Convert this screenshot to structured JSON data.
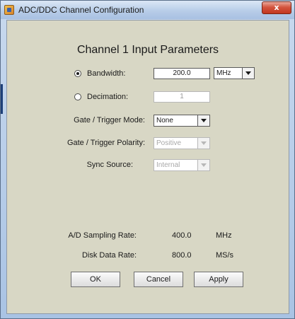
{
  "window": {
    "title": "ADC/DDC Channel Configuration",
    "close_glyph": "x"
  },
  "form": {
    "heading": "Channel 1 Input Parameters",
    "bandwidth": {
      "label": "Bandwidth:",
      "value": "200.0",
      "unit": "MHz",
      "selected": true
    },
    "decimation": {
      "label": "Decimation:",
      "value": "1",
      "selected": false
    },
    "gate_mode": {
      "label": "Gate / Trigger Mode:",
      "value": "None"
    },
    "gate_polarity": {
      "label": "Gate / Trigger Polarity:",
      "value": "Positive"
    },
    "sync_source": {
      "label": "Sync Source:",
      "value": "Internal"
    }
  },
  "info": {
    "sampling_rate": {
      "label": "A/D Sampling Rate:",
      "value": "400.0",
      "unit": "MHz"
    },
    "disk_rate": {
      "label": "Disk Data Rate:",
      "value": "800.0",
      "unit": "MS/s"
    }
  },
  "buttons": {
    "ok": "OK",
    "cancel": "Cancel",
    "apply": "Apply"
  },
  "colors": {
    "panel": "#d8d7c5",
    "titlebar": "#b8cde8",
    "close": "#c2361f"
  }
}
